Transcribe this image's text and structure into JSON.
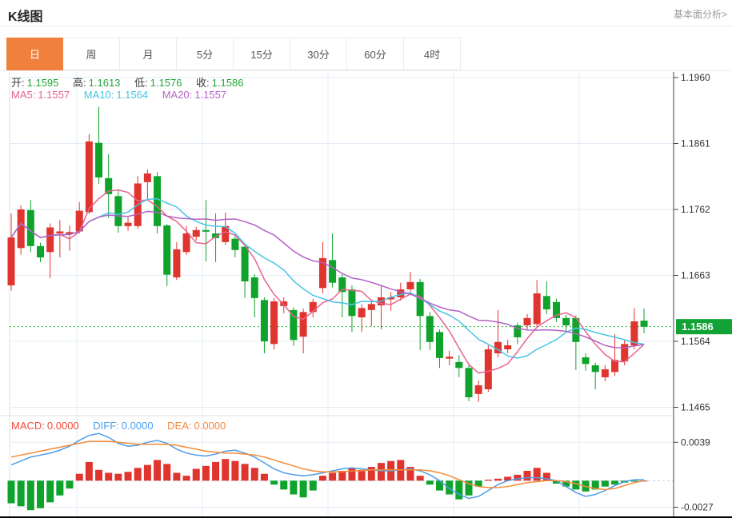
{
  "header": {
    "title": "K线图",
    "link": "基本面分析>"
  },
  "tabs": {
    "items": [
      "日",
      "周",
      "月",
      "5分",
      "15分",
      "30分",
      "60分",
      "4时"
    ],
    "active_index": 0
  },
  "legend": {
    "open_label": "开:",
    "open": "1.1595",
    "high_label": "高:",
    "high": "1.1613",
    "low_label": "低:",
    "low": "1.1576",
    "close_label": "收:",
    "close": "1.1586",
    "ma5_label": "MA5:",
    "ma5": "1.1557",
    "ma10_label": "MA10:",
    "ma10": "1.1564",
    "ma20_label": "MA20:",
    "ma20": "1.1557"
  },
  "macd_legend": {
    "macd_label": "MACD:",
    "macd": "0.0000",
    "diff_label": "DIFF:",
    "diff": "0.0000",
    "dea_label": "DEA:",
    "dea": "0.0000"
  },
  "colors": {
    "up": "#e0342f",
    "down": "#10a32c",
    "ma5": "#e8638f",
    "ma10": "#49c4e5",
    "ma20": "#b361c6",
    "diff": "#4f9ce8",
    "dea": "#f58b37",
    "tab_active": "#f0813d",
    "price_tag_bg": "#12a336",
    "grid": "#e3ecf4",
    "axis": "#444444",
    "border": "#e0e0e0",
    "dotted_price_line": "#21a637",
    "zero_dash": "#b9d4ea"
  },
  "chart_data": {
    "type": "candlestick+macd",
    "title": "K线图",
    "legend_position": "top-left",
    "grid": true,
    "price_ticks": [
      "1.1960",
      "1.1861",
      "1.1762",
      "1.1663",
      "1.1564",
      "1.1465"
    ],
    "price_range": [
      1.196,
      1.1465
    ],
    "current_price": 1.1586,
    "current_price_label": "1.1586",
    "macd_ticks": [
      "0.0039",
      "-0.0027"
    ],
    "macd_range": [
      0.0039,
      -0.0027
    ],
    "candles_ohlc_order": [
      "open",
      "high",
      "low",
      "close"
    ],
    "candles": [
      [
        1.1648,
        1.1756,
        1.164,
        1.172
      ],
      [
        1.1704,
        1.1768,
        1.1694,
        1.1762
      ],
      [
        1.1761,
        1.1776,
        1.1698,
        1.1707
      ],
      [
        1.1707,
        1.1712,
        1.1683,
        1.169
      ],
      [
        1.1698,
        1.1741,
        1.1659,
        1.1735
      ],
      [
        1.1726,
        1.1746,
        1.169,
        1.1729
      ],
      [
        1.1725,
        1.1738,
        1.17,
        1.1728
      ],
      [
        1.1729,
        1.1773,
        1.1726,
        1.176
      ],
      [
        1.1758,
        1.1875,
        1.1755,
        1.1864
      ],
      [
        1.1862,
        1.1916,
        1.18,
        1.181
      ],
      [
        1.1809,
        1.1845,
        1.1749,
        1.1785
      ],
      [
        1.1782,
        1.179,
        1.1727,
        1.1737
      ],
      [
        1.1737,
        1.175,
        1.173,
        1.1742
      ],
      [
        1.1737,
        1.1812,
        1.1733,
        1.1801
      ],
      [
        1.1803,
        1.1822,
        1.1776,
        1.1816
      ],
      [
        1.1812,
        1.1818,
        1.1726,
        1.1737
      ],
      [
        1.1738,
        1.174,
        1.1647,
        1.1664
      ],
      [
        1.166,
        1.1713,
        1.1656,
        1.1702
      ],
      [
        1.1698,
        1.1737,
        1.1694,
        1.1726
      ],
      [
        1.1721,
        1.1736,
        1.1715,
        1.1731
      ],
      [
        1.1731,
        1.1776,
        1.1684,
        1.1729
      ],
      [
        1.1726,
        1.1756,
        1.1683,
        1.1719
      ],
      [
        1.1713,
        1.1757,
        1.1709,
        1.1737
      ],
      [
        1.1718,
        1.1722,
        1.169,
        1.1701
      ],
      [
        1.1706,
        1.171,
        1.1629,
        1.1654
      ],
      [
        1.166,
        1.1665,
        1.16,
        1.1629
      ],
      [
        1.1626,
        1.163,
        1.1546,
        1.1564
      ],
      [
        1.156,
        1.1629,
        1.1552,
        1.1624
      ],
      [
        1.1617,
        1.163,
        1.1606,
        1.1624
      ],
      [
        1.1611,
        1.1615,
        1.1557,
        1.1566
      ],
      [
        1.1571,
        1.1613,
        1.1546,
        1.1608
      ],
      [
        1.1608,
        1.1628,
        1.16,
        1.1623
      ],
      [
        1.1644,
        1.1713,
        1.1636,
        1.1689
      ],
      [
        1.1686,
        1.1726,
        1.1645,
        1.1652
      ],
      [
        1.166,
        1.1665,
        1.16,
        1.1638
      ],
      [
        1.1642,
        1.1648,
        1.1578,
        1.1602
      ],
      [
        1.16,
        1.162,
        1.1578,
        1.1614
      ],
      [
        1.1611,
        1.1625,
        1.1587,
        1.162
      ],
      [
        1.1618,
        1.1647,
        1.1582,
        1.163
      ],
      [
        1.1627,
        1.1638,
        1.161,
        1.163
      ],
      [
        1.163,
        1.1652,
        1.1625,
        1.1642
      ],
      [
        1.1642,
        1.1668,
        1.1638,
        1.1653
      ],
      [
        1.1653,
        1.1658,
        1.1551,
        1.1602
      ],
      [
        1.1602,
        1.1608,
        1.1551,
        1.1563
      ],
      [
        1.1578,
        1.1582,
        1.1524,
        1.1539
      ],
      [
        1.1538,
        1.155,
        1.1528,
        1.1541
      ],
      [
        1.1533,
        1.1543,
        1.151,
        1.1524
      ],
      [
        1.1524,
        1.1528,
        1.1474,
        1.148
      ],
      [
        1.1485,
        1.1505,
        1.1473,
        1.1498
      ],
      [
        1.1492,
        1.1558,
        1.1488,
        1.1552
      ],
      [
        1.1546,
        1.1611,
        1.154,
        1.1563
      ],
      [
        1.1552,
        1.1566,
        1.1546,
        1.1558
      ],
      [
        1.1588,
        1.1592,
        1.156,
        1.157
      ],
      [
        1.1588,
        1.1605,
        1.1582,
        1.1599
      ],
      [
        1.159,
        1.1656,
        1.1586,
        1.1636
      ],
      [
        1.1632,
        1.1654,
        1.1605,
        1.1612
      ],
      [
        1.1623,
        1.1628,
        1.1593,
        1.1599
      ],
      [
        1.1599,
        1.1604,
        1.158,
        1.1588
      ],
      [
        1.1599,
        1.1603,
        1.1521,
        1.1563
      ],
      [
        1.154,
        1.1546,
        1.152,
        1.153
      ],
      [
        1.1528,
        1.1532,
        1.1492,
        1.1518
      ],
      [
        1.151,
        1.1528,
        1.1504,
        1.1522
      ],
      [
        1.1518,
        1.1575,
        1.1512,
        1.1536
      ],
      [
        1.1534,
        1.1566,
        1.1528,
        1.156
      ],
      [
        1.1558,
        1.1614,
        1.1552,
        1.1594
      ],
      [
        1.1595,
        1.1613,
        1.1576,
        1.1586
      ]
    ],
    "macd_bars": [
      -0.0023,
      -0.0026,
      -0.003,
      -0.0028,
      -0.0022,
      -0.0015,
      -0.0008,
      0.0007,
      0.0019,
      0.0011,
      0.0008,
      0.0007,
      0.0009,
      0.0013,
      0.0016,
      0.0021,
      0.0017,
      0.0008,
      0.0005,
      0.0012,
      0.0015,
      0.0019,
      0.0022,
      0.002,
      0.0017,
      0.0013,
      0.0007,
      -0.0004,
      -0.0009,
      -0.0014,
      -0.0017,
      -0.001,
      0.0005,
      0.0008,
      0.001,
      0.0013,
      0.0011,
      0.0014,
      0.0018,
      0.002,
      0.0021,
      0.0014,
      0.0005,
      -0.0004,
      -0.001,
      -0.0014,
      -0.0019,
      -0.0015,
      -0.0006,
      0.0001,
      0.0002,
      0.0004,
      0.0006,
      0.001,
      0.0013,
      0.0008,
      -0.0003,
      -0.0006,
      -0.0009,
      -0.0011,
      -0.0009,
      -0.0006,
      -0.0004,
      -0.0002,
      -0.0001,
      0.0
    ],
    "diff_line": [
      0.0016,
      0.002,
      0.0024,
      0.0026,
      0.0028,
      0.0031,
      0.0035,
      0.0041,
      0.0046,
      0.0048,
      0.0044,
      0.0038,
      0.0035,
      0.0036,
      0.0039,
      0.0041,
      0.0038,
      0.0032,
      0.0028,
      0.0026,
      0.0025,
      0.0027,
      0.003,
      0.0031,
      0.0028,
      0.0024,
      0.0018,
      0.0012,
      0.0008,
      0.0006,
      0.0005,
      0.0006,
      0.0008,
      0.001,
      0.0012,
      0.0013,
      0.0012,
      0.0011,
      0.001,
      0.001,
      0.0011,
      0.0012,
      0.001,
      0.0006,
      0.0,
      -0.0008,
      -0.0014,
      -0.0018,
      -0.0016,
      -0.001,
      -0.0004,
      0.0,
      0.0002,
      0.0003,
      0.0003,
      0.0002,
      0.0,
      -0.0006,
      -0.0012,
      -0.0016,
      -0.0014,
      -0.001,
      -0.0005,
      -0.0001,
      0.0001,
      0.0001
    ],
    "dea_line": [
      0.0024,
      0.0026,
      0.0028,
      0.003,
      0.0032,
      0.0034,
      0.0036,
      0.0038,
      0.004,
      0.004,
      0.004,
      0.0039,
      0.0038,
      0.0037,
      0.0037,
      0.0037,
      0.0037,
      0.0036,
      0.0034,
      0.0032,
      0.003,
      0.0029,
      0.0028,
      0.0028,
      0.0027,
      0.0026,
      0.0024,
      0.0021,
      0.0018,
      0.0015,
      0.0012,
      0.001,
      0.0009,
      0.0009,
      0.0009,
      0.001,
      0.001,
      0.0011,
      0.0011,
      0.0011,
      0.0011,
      0.0011,
      0.0011,
      0.001,
      0.0008,
      0.0005,
      0.0001,
      -0.0003,
      -0.0006,
      -0.0007,
      -0.0007,
      -0.0006,
      -0.0004,
      -0.0002,
      -0.0001,
      0.0,
      0.0,
      -0.0001,
      -0.0003,
      -0.0006,
      -0.0008,
      -0.0009,
      -0.0008,
      -0.0005,
      -0.0002,
      0.0
    ]
  }
}
